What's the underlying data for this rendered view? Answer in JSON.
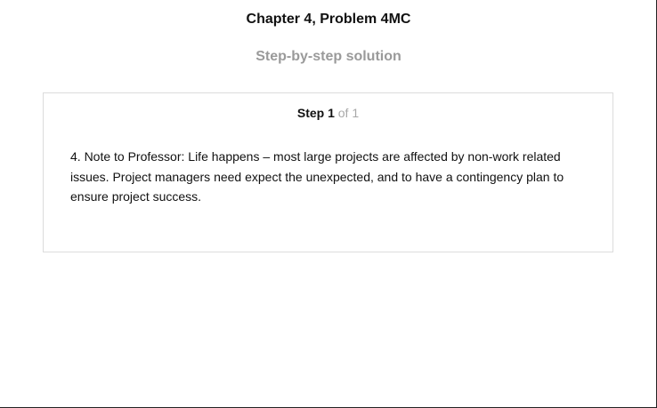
{
  "header": {
    "title": "Chapter 4, Problem 4MC",
    "subtitle": "Step-by-step solution"
  },
  "step": {
    "label": "Step 1",
    "of_text": "of 1",
    "body": "4. Note to Professor: Life happens – most large projects are affected by non-work related issues. Project managers need expect the unexpected, and to have a contingency plan to ensure project success."
  }
}
